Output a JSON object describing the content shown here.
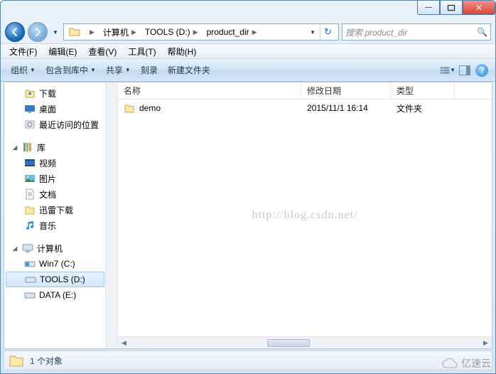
{
  "titlebar": {
    "min": "—",
    "max": "❐",
    "close": "✕"
  },
  "nav": {
    "crumbs": [
      "计算机",
      "TOOLS (D:)",
      "product_dir"
    ],
    "search_placeholder": "搜索 product_dir"
  },
  "menu": {
    "file": "文件(F)",
    "edit": "编辑(E)",
    "view": "查看(V)",
    "tools": "工具(T)",
    "help": "帮助(H)"
  },
  "toolbar": {
    "organize": "组织",
    "include": "包含到库中",
    "share": "共享",
    "burn": "刻录",
    "newfolder": "新建文件夹"
  },
  "tree": {
    "downloads": "下载",
    "desktop": "桌面",
    "recent": "最近访问的位置",
    "libraries": "库",
    "videos": "视频",
    "pictures": "图片",
    "documents": "文档",
    "xunlei": "迅雷下载",
    "music": "音乐",
    "computer": "计算机",
    "c": "Win7 (C:)",
    "d": "TOOLS (D:)",
    "e": "DATA (E:)"
  },
  "columns": {
    "name": "名称",
    "modified": "修改日期",
    "type": "类型"
  },
  "rows": [
    {
      "name": "demo",
      "modified": "2015/11/1 16:14",
      "type": "文件夹"
    }
  ],
  "status": {
    "count": "1 个对象"
  },
  "watermark": "http://blog.csdn.net/",
  "brand": "亿速云"
}
